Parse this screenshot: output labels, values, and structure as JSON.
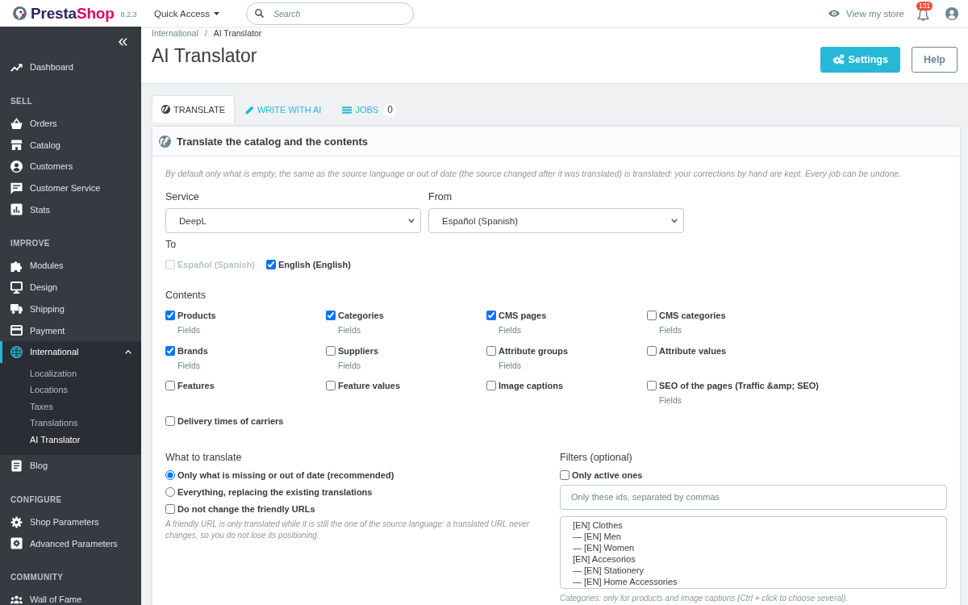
{
  "topbar": {
    "brand": {
      "first": "Presta",
      "second": "Shop"
    },
    "version": "8.2.3",
    "quick_access": "Quick Access",
    "search": {
      "placeholder": "Search"
    },
    "view_store": "View my store",
    "notifications": "131"
  },
  "sidebar": {
    "sections": [
      {
        "items": [
          {
            "label": "Dashboard",
            "selected": false
          }
        ]
      },
      {
        "title": "SELL",
        "items": [
          {
            "label": "Orders",
            "selected": false
          },
          {
            "label": "Catalog",
            "selected": false
          },
          {
            "label": "Customers",
            "selected": false
          },
          {
            "label": "Customer Service",
            "selected": false
          },
          {
            "label": "Stats",
            "selected": false
          }
        ]
      },
      {
        "title": "IMPROVE",
        "items": [
          {
            "label": "Modules",
            "selected": false
          },
          {
            "label": "Design",
            "selected": false
          },
          {
            "label": "Shipping",
            "selected": false
          },
          {
            "label": "Payment",
            "selected": false
          },
          {
            "label": "International",
            "selected": true,
            "expanded": true,
            "children": [
              {
                "label": "Localization",
                "selected": false
              },
              {
                "label": "Locations",
                "selected": false
              },
              {
                "label": "Taxes",
                "selected": false
              },
              {
                "label": "Translations",
                "selected": false
              },
              {
                "label": "AI Translator",
                "selected": true
              }
            ]
          },
          {
            "label": "Blog",
            "selected": false
          }
        ]
      },
      {
        "title": "CONFIGURE",
        "items": [
          {
            "label": "Shop Parameters",
            "selected": false
          },
          {
            "label": "Advanced Parameters",
            "selected": false
          }
        ]
      },
      {
        "title": "COMMUNITY",
        "items": [
          {
            "label": "Wall of Fame",
            "selected": false
          }
        ]
      }
    ]
  },
  "header": {
    "breadcrumb": {
      "items": [
        "International",
        "AI Translator"
      ],
      "separator": "/"
    },
    "title": "AI Translator",
    "buttons": [
      {
        "label": "Settings",
        "kind": "primary"
      },
      {
        "label": "Help",
        "kind": "outline"
      }
    ]
  },
  "tabs": [
    {
      "label": "TRANSLATE",
      "selected": true
    },
    {
      "label": "WRITE WITH AI",
      "selected": false
    },
    {
      "label": "JOBS",
      "selected": false,
      "count": "0"
    }
  ],
  "panel": {
    "title": "Translate the catalog and the contents",
    "note": "By default only what is empty, the same as the source language or out of date (the source changed after it was translated) is translated: your corrections by hand are kept. Every job can be undone.",
    "service": {
      "label": "Service",
      "value": "DeepL"
    },
    "from": {
      "label": "From",
      "value": "Español (Spanish)"
    },
    "to": {
      "label": "To",
      "options": [
        {
          "label": "Español (Spanish)",
          "checked": false,
          "disabled": true
        },
        {
          "label": "English (English)",
          "checked": true,
          "disabled": false
        }
      ]
    },
    "contents": {
      "label": "Contents",
      "items": [
        {
          "label": "Products",
          "checked": true,
          "fields": "Fields"
        },
        {
          "label": "Categories",
          "checked": true,
          "fields": "Fields"
        },
        {
          "label": "CMS pages",
          "checked": true,
          "fields": "Fields"
        },
        {
          "label": "CMS categories",
          "checked": false,
          "fields": "Fields"
        },
        {
          "label": "Brands",
          "checked": true,
          "fields": "Fields"
        },
        {
          "label": "Suppliers",
          "checked": false,
          "fields": "Fields"
        },
        {
          "label": "Attribute groups",
          "checked": false,
          "fields": "Fields"
        },
        {
          "label": "Attribute values",
          "checked": false
        },
        {
          "label": "Features",
          "checked": false
        },
        {
          "label": "Feature values",
          "checked": false
        },
        {
          "label": "Image captions",
          "checked": false
        },
        {
          "label": "SEO of the pages (Traffic &amp; SEO)",
          "checked": false,
          "fields": "Fields"
        },
        {
          "label": "Delivery times of carriers",
          "checked": false
        }
      ]
    },
    "what_to_translate": {
      "label": "What to translate",
      "options": [
        {
          "kind": "radio",
          "label": "Only what is missing or out of date (recommended)",
          "selected": true
        },
        {
          "kind": "radio",
          "label": "Everything, replacing the existing translations",
          "selected": false
        },
        {
          "kind": "checkbox",
          "label": "Do not change the friendly URLs",
          "checked": false
        }
      ],
      "note": "A friendly URL is only translated while it is still the one of the source language: a translated URL never changes, so you do not lose its positioning."
    },
    "filters": {
      "label": "Filters (optional)",
      "active_only": {
        "label": "Only active ones",
        "checked": false
      },
      "ids": {
        "placeholder": "Only these ids, separated by commas"
      },
      "categories": {
        "options": [
          {
            "label": "[EN] Clothes",
            "selected": false,
            "children": [
              {
                "label": "— [EN] Men",
                "selected": false
              },
              {
                "label": "— [EN] Women",
                "selected": false
              }
            ]
          },
          {
            "label": "[EN] Accesorios",
            "selected": false,
            "children": [
              {
                "label": "— [EN] Stationery",
                "selected": false
              },
              {
                "label": "— [EN] Home Accessories",
                "selected": false
              }
            ]
          }
        ]
      },
      "note": "Categories: only for products and image captions (Ctrl + click to choose several)."
    }
  }
}
